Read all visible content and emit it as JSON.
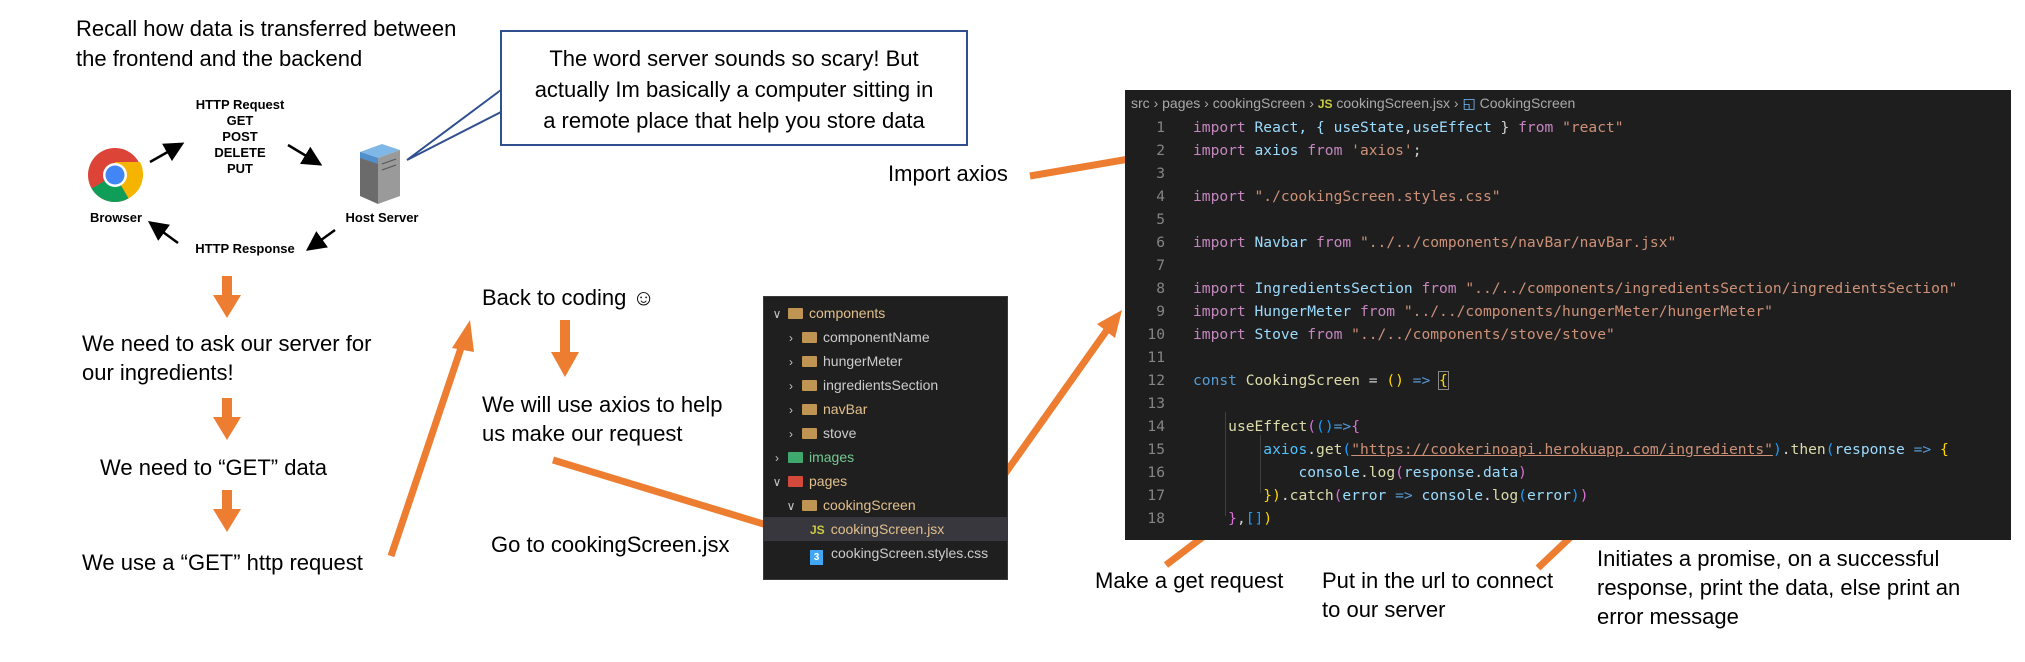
{
  "intro": {
    "recall_line1": "Recall how data is transferred between",
    "recall_line2": "the frontend and the backend"
  },
  "http_diagram": {
    "request_title": "HTTP Request",
    "methods": [
      "GET",
      "POST",
      "DELETE",
      "PUT"
    ],
    "response": "HTTP Response",
    "browser_label": "Browser",
    "server_label": "Host Server"
  },
  "callout": {
    "line1": "The word server sounds so scary! But",
    "line2": "actually Im basically a computer sitting in",
    "line3": "a remote place that help you store data"
  },
  "steps": {
    "ask_line1": "We need to ask our server for",
    "ask_line2": "our ingredients!",
    "get_data": "We need to “GET” data",
    "get_request": "We use a “GET” http request",
    "back_to_coding": "Back to coding ☺",
    "axios_line1": "We will use axios to help",
    "axios_line2": "us make our request",
    "goto_file": "Go to cookingScreen.jsx",
    "import_axios": "Import axios",
    "make_get": "Make a get request",
    "url_line1": "Put in the url to connect",
    "url_line2": "to our server",
    "promise_line1": "Initiates a promise, on a successful",
    "promise_line2": "response, print the data, else print an",
    "promise_line3": "error message"
  },
  "explorer": {
    "items": [
      {
        "label": "components",
        "indent": 0,
        "chev": "v",
        "color": "orange"
      },
      {
        "label": "componentName",
        "indent": 1,
        "chev": ">",
        "color": "orange"
      },
      {
        "label": "hungerMeter",
        "indent": 1,
        "chev": ">",
        "color": "orange"
      },
      {
        "label": "ingredientsSection",
        "indent": 1,
        "chev": ">",
        "color": "orange"
      },
      {
        "label": "navBar",
        "indent": 1,
        "chev": ">",
        "color": "orange"
      },
      {
        "label": "stove",
        "indent": 1,
        "chev": ">",
        "color": "orange"
      },
      {
        "label": "images",
        "indent": 0,
        "chev": ">",
        "color": "green"
      },
      {
        "label": "pages",
        "indent": 0,
        "chev": "v",
        "color": "red"
      },
      {
        "label": "cookingScreen",
        "indent": 1,
        "chev": "v",
        "color": "orange"
      },
      {
        "label": "cookingScreen.jsx",
        "indent": 2,
        "chev": "",
        "color": "js"
      },
      {
        "label": "cookingScreen.styles.css",
        "indent": 2,
        "chev": "",
        "color": "css"
      }
    ],
    "js_badge": "JS",
    "css_badge": "3"
  },
  "editor": {
    "breadcrumb": [
      "src",
      "pages",
      "cookingScreen",
      "cookingScreen.jsx",
      "CookingScreen"
    ],
    "js_badge": "JS",
    "line_numbers": [
      "1",
      "2",
      "3",
      "4",
      "5",
      "6",
      "7",
      "8",
      "9",
      "10",
      "11",
      "12",
      "13",
      "14",
      "15",
      "16",
      "17",
      "18"
    ],
    "code": {
      "l1": [
        "import",
        " React, { ",
        "useState",
        ",",
        "useEffect",
        " } ",
        "from",
        " \"react\""
      ],
      "l2": [
        "import",
        " axios ",
        "from",
        " 'axios'",
        ";"
      ],
      "l4": [
        "import",
        " \"./cookingScreen.styles.css\""
      ],
      "l6": [
        "import",
        " Navbar ",
        "from",
        " \"../../components/navBar/navBar.jsx\""
      ],
      "l8": [
        "import",
        " IngredientsSection ",
        "from",
        " \"../../components/ingredientsSection/ingredientsSection\""
      ],
      "l9": [
        "import",
        " HungerMeter ",
        "from",
        " \"../../components/hungerMeter/hungerMeter\""
      ],
      "l10": [
        "import",
        " Stove ",
        "from",
        " \"../../components/stove/stove\""
      ],
      "l12": [
        "const",
        " CookingScreen ",
        "= ",
        "()",
        " => ",
        "{"
      ],
      "l14": [
        "useEffect",
        "(",
        "()",
        "=>",
        "{"
      ],
      "l15": [
        "axios",
        ".",
        "get",
        "(",
        "\"https://cookerinoapi.herokuapp.com/ingredients\"",
        ")",
        ".",
        "then",
        "(",
        "response",
        " => ",
        "{"
      ],
      "l16": [
        "console",
        ".",
        "log",
        "(",
        "response",
        ".",
        "data",
        ")"
      ],
      "l17": [
        "})",
        ".",
        "catch",
        "(",
        "error",
        " => ",
        "console",
        ".",
        "log",
        "(",
        "error",
        ")",
        ")"
      ],
      "l18": [
        "}",
        ",",
        "[]",
        ")"
      ]
    }
  },
  "colors": {
    "arrow": "#ed7d31",
    "callout_border": "#2f4f8f",
    "editor_bg": "#1e1e1e",
    "explorer_bg": "#1f1f1f"
  }
}
